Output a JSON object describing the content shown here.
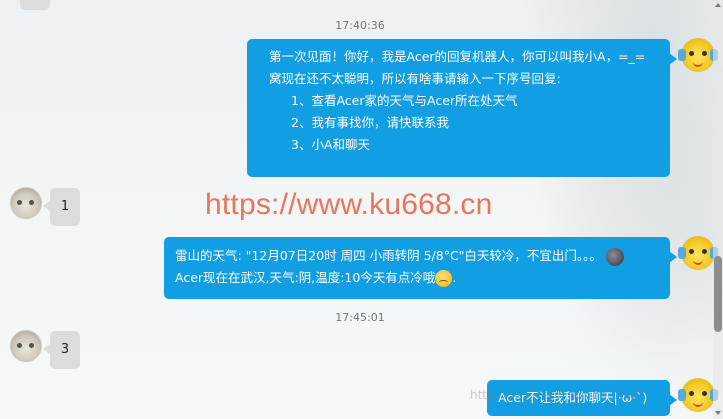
{
  "messages": {
    "time1": "17:40:36",
    "bot1": {
      "line1": "第一次见面！你好，我是Acer的回复机器人，你可以叫我小A，=_=",
      "line2": "窝现在还不太聪明，所以有啥事请输入一下序号回复:",
      "option1": "1、查看Acer家的天气与Acer所在处天气",
      "option2": "2、我有事找你，请快联系我",
      "option3": "3、小A和聊天"
    },
    "user1": "1",
    "bot2": {
      "line1": "雷山的天气: \"12月07日20时 周四  小雨转阴  5/8°C\"白天较冷，不宜出门。。。",
      "line2": "Acer现在在武汉,天气:阴,温度:10今天有点冷哦",
      "line2_end": "."
    },
    "time2": "17:45:01",
    "user2": "3",
    "bot3": "Acer不让我和你聊天|·ω·`)"
  },
  "watermark": "https://www.ku668.cn",
  "faint_watermark": "http://blog.csdn.net/qq_2107...",
  "colors": {
    "bubble_blue": "#119ee2",
    "bubble_gray": "#dcdcdc",
    "watermark": "#e8765c"
  },
  "icons": {
    "bot_avatar": "bot-avatar-icon",
    "user_avatar": "user-avatar-icon",
    "rain_cloud_emoji": "dark-moon-emoji-icon",
    "sad_emoji": "sad-face-emoji-icon"
  }
}
